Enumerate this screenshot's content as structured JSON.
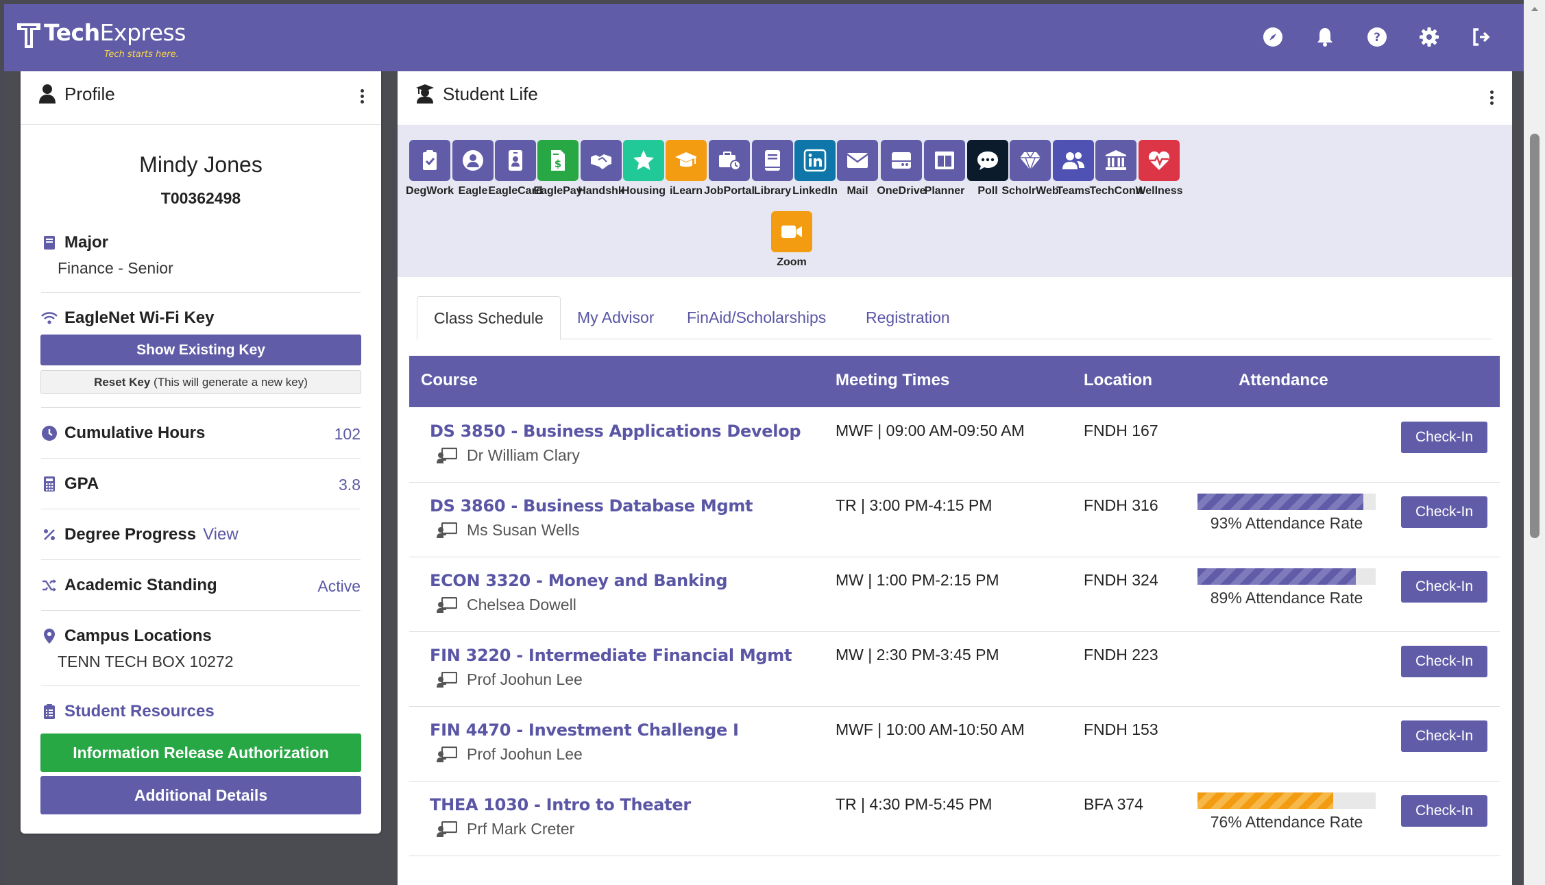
{
  "header": {
    "brand_bold": "Tech",
    "brand_light": "Express",
    "tagline": "Tech starts here.",
    "icons": [
      "compass-icon",
      "bell-icon",
      "help-icon",
      "gear-icon",
      "logout-icon"
    ]
  },
  "profile": {
    "title": "Profile",
    "name": "Mindy Jones",
    "student_id": "T00362498",
    "major_label": "Major",
    "major_value": "Finance - Senior",
    "wifi_label": "EagleNet Wi-Fi Key",
    "show_key": "Show Existing Key",
    "reset_key": "Reset Key",
    "reset_key_note": "(This will generate a new key)",
    "hours_label": "Cumulative Hours",
    "hours_value": "102",
    "gpa_label": "GPA",
    "gpa_value": "3.8",
    "degree_label": "Degree Progress",
    "degree_link": "View",
    "standing_label": "Academic Standing",
    "standing_value": "Active",
    "campus_label": "Campus Locations",
    "campus_value": "TENN TECH BOX 10272",
    "resources_label": "Student Resources",
    "info_release": "Information Release Authorization",
    "additional": "Additional Details"
  },
  "student_life": {
    "title": "Student Life",
    "apps": [
      {
        "label": "DegWork",
        "color": "#605ca8",
        "icon": "clipboard-check-icon"
      },
      {
        "label": "Eagle",
        "color": "#605ca8",
        "icon": "user-circle-icon"
      },
      {
        "label": "EagleCard",
        "color": "#605ca8",
        "icon": "id-badge-icon"
      },
      {
        "label": "EaglePay",
        "color": "#28a745",
        "icon": "invoice-dollar-icon"
      },
      {
        "label": "Handshk",
        "color": "#605ca8",
        "icon": "handshake-icon"
      },
      {
        "label": "Housing",
        "color": "#20c997",
        "icon": "star-icon"
      },
      {
        "label": "iLearn",
        "color": "#f39c12",
        "icon": "graduation-cap-icon"
      },
      {
        "label": "JobPortal",
        "color": "#605ca8",
        "icon": "briefcase-clock-icon"
      },
      {
        "label": "Library",
        "color": "#605ca8",
        "icon": "book-icon"
      },
      {
        "label": "LinkedIn",
        "color": "#0e76a8",
        "icon": "linkedin-icon"
      },
      {
        "label": "Mail",
        "color": "#605ca8",
        "icon": "envelope-icon"
      },
      {
        "label": "OneDrive",
        "color": "#605ca8",
        "icon": "hard-drive-icon"
      },
      {
        "label": "Planner",
        "color": "#605ca8",
        "icon": "columns-icon"
      },
      {
        "label": "Poll",
        "color": "#0b1b2b",
        "icon": "comment-dots-icon"
      },
      {
        "label": "ScholrWeb",
        "color": "#605ca8",
        "icon": "gem-icon"
      },
      {
        "label": "Teams",
        "color": "#4f52b2",
        "icon": "users-icon"
      },
      {
        "label": "TechConn",
        "color": "#605ca8",
        "icon": "university-icon"
      },
      {
        "label": "Wellness",
        "color": "#dc3545",
        "icon": "heartbeat-icon"
      },
      {
        "label": "Zoom",
        "color": "#f39c12",
        "icon": "video-icon"
      }
    ],
    "tabs": [
      "Class Schedule",
      "My Advisor",
      "FinAid/Scholarships",
      "Registration"
    ],
    "table_headers": {
      "course": "Course",
      "times": "Meeting Times",
      "location": "Location",
      "attendance": "Attendance"
    },
    "rows": [
      {
        "course": "DS 3850 - Business Applications Develop",
        "instructor": "Dr William Clary",
        "times": "MWF | 09:00 AM-09:50 AM",
        "location": "FNDH 167",
        "attendance": null,
        "attendance_text": "",
        "bar_color": "",
        "checkin": "Check-In"
      },
      {
        "course": "DS 3860 - Business Database Mgmt",
        "instructor": "Ms Susan Wells",
        "times": "TR | 3:00 PM-4:15 PM",
        "location": "FNDH 316",
        "attendance": 93,
        "attendance_text": "93% Attendance Rate",
        "bar_color": "purple",
        "checkin": "Check-In"
      },
      {
        "course": "ECON 3320 - Money and Banking",
        "instructor": " Chelsea Dowell",
        "times": "MW | 1:00 PM-2:15 PM",
        "location": "FNDH 324",
        "attendance": 89,
        "attendance_text": "89% Attendance Rate",
        "bar_color": "purple",
        "checkin": "Check-In"
      },
      {
        "course": "FIN 3220 - Intermediate Financial Mgmt",
        "instructor": "Prof Joohun Lee",
        "times": "MW | 2:30 PM-3:45 PM",
        "location": "FNDH 223",
        "attendance": null,
        "attendance_text": "",
        "bar_color": "",
        "checkin": "Check-In"
      },
      {
        "course": "FIN 4470 - Investment Challenge I",
        "instructor": "Prof Joohun Lee",
        "times": "MWF | 10:00 AM-10:50 AM",
        "location": "FNDH 153",
        "attendance": null,
        "attendance_text": "",
        "bar_color": "",
        "checkin": "Check-In"
      },
      {
        "course": "THEA 1030 - Intro to Theater",
        "instructor": "Prf Mark Creter",
        "times": "TR | 4:30 PM-5:45 PM",
        "location": "BFA 374",
        "attendance": 76,
        "attendance_text": "76% Attendance Rate",
        "bar_color": "orange",
        "checkin": "Check-In"
      }
    ]
  }
}
